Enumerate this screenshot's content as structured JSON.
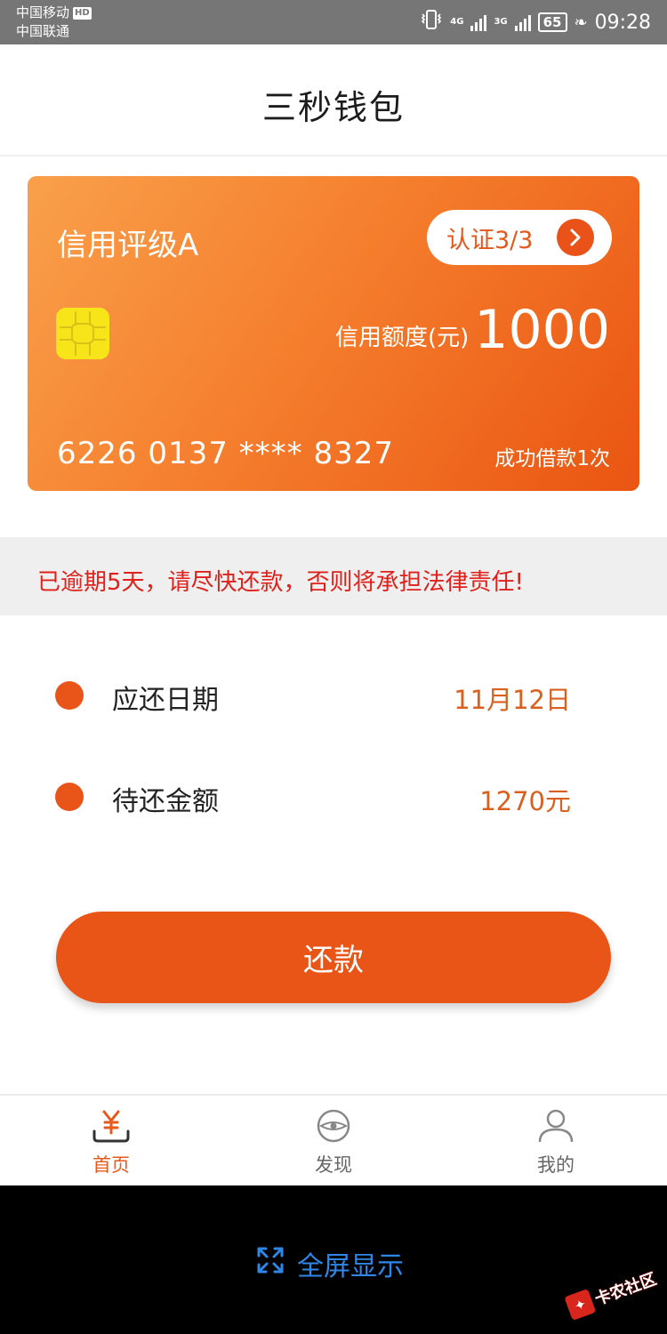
{
  "status_bar": {
    "carrier_1": "中国移动",
    "carrier_1_badge": "HD",
    "carrier_2": "中国联通",
    "network_1": "4G",
    "network_2": "3G",
    "battery": "65",
    "time": "09:28"
  },
  "header": {
    "title": "三秒钱包"
  },
  "card": {
    "rating": "信用评级A",
    "auth_label": "认证3/3",
    "limit_label": "信用额度(元)",
    "limit_value": "1000",
    "card_number": "6226 0137 **** 8327",
    "loan_count": "成功借款1次",
    "gradient_start": "#f9a04b",
    "gradient_end": "#ea5512"
  },
  "notice": {
    "text": "已逾期5天，请尽快还款，否则将承担法律责任!"
  },
  "repayment": {
    "rows": [
      {
        "label": "应还日期",
        "value": "11月12日"
      },
      {
        "label": "待还金额",
        "value": "1270元"
      }
    ]
  },
  "repay_button": {
    "label": "还款"
  },
  "bottom_nav": {
    "items": [
      {
        "label": "首页",
        "icon": "yen-wallet-icon"
      },
      {
        "label": "发现",
        "icon": "eye-circle-icon"
      },
      {
        "label": "我的",
        "icon": "user-icon"
      }
    ]
  },
  "system_bar": {
    "fullscreen_label": "全屏显示"
  },
  "watermark": {
    "text": "卡农社区"
  },
  "colors": {
    "accent": "#e95516",
    "warning": "#e0211b",
    "link": "#2f86e6"
  }
}
